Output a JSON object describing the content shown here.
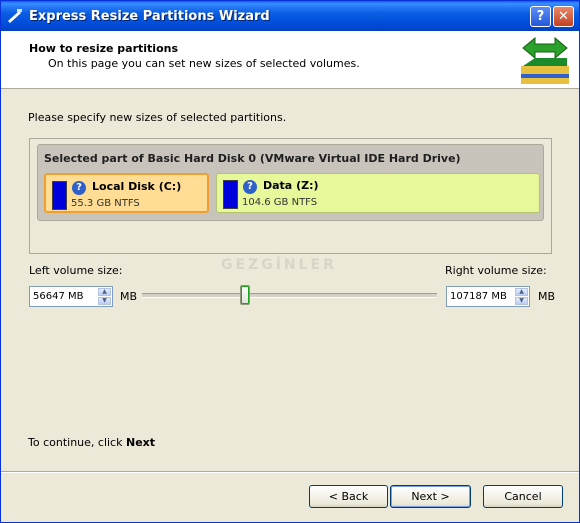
{
  "window": {
    "title": "Express Resize Partitions Wizard",
    "help_label": "?",
    "close_label": "✕"
  },
  "header": {
    "title": "How to resize partitions",
    "subtitle": "On this page you can set new sizes of selected volumes."
  },
  "instruction": "Please specify new sizes of selected partitions.",
  "disk": {
    "title": "Selected part of Basic Hard Disk 0 (VMware Virtual IDE Hard Drive)",
    "partitions": [
      {
        "name": "Local Disk (C:)",
        "info": "55.3 GB NTFS",
        "icon": "?",
        "bar_color": "#0000dc"
      },
      {
        "name": "Data (Z:)",
        "info": "104.6 GB NTFS",
        "icon": "?",
        "bar_color": "#0000dc"
      }
    ]
  },
  "watermark": "GEZGİNLER",
  "resize": {
    "left_label": "Left volume size:",
    "right_label": "Right volume size:",
    "left_value": "56647 MB",
    "right_value": "107187 MB",
    "left_unit": "MB",
    "right_unit": "MB",
    "slider_position": 0.35
  },
  "continue": {
    "text": "To continue, click ",
    "emphasis": "Next"
  },
  "buttons": {
    "back": "< Back",
    "next": "Next >",
    "cancel": "Cancel"
  },
  "colors": {
    "accent": "#0a5ee3",
    "partition_c": "#ffdd95",
    "partition_z": "#e6f89a"
  }
}
